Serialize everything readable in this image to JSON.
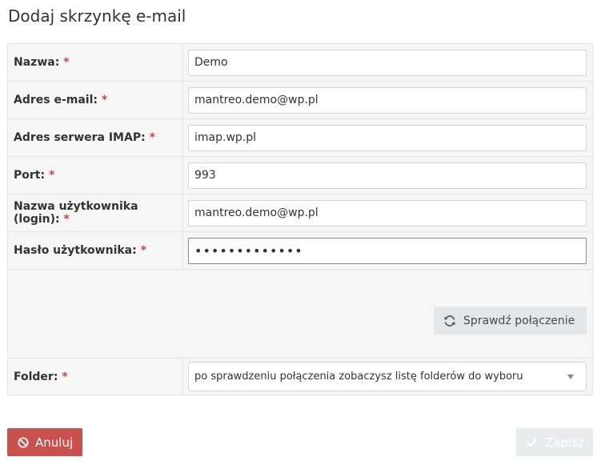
{
  "page": {
    "title": "Dodaj skrzynkę e-mail"
  },
  "form": {
    "required_marker": "*",
    "fields": [
      {
        "label": "Nazwa:",
        "value": "Demo"
      },
      {
        "label": "Adres e-mail:",
        "value": "mantreo.demo@wp.pl"
      },
      {
        "label": "Adres serwera IMAP:",
        "value": "imap.wp.pl"
      },
      {
        "label": "Port:",
        "value": "993"
      },
      {
        "label": "Nazwa użytkownika (login):",
        "value": "mantreo.demo@wp.pl"
      },
      {
        "label": "Hasło użytkownika:",
        "value": "•••••••••••••"
      }
    ],
    "check_connection": {
      "label": "Sprawdź połączenie",
      "icon": "refresh-icon"
    },
    "folder": {
      "label": "Folder:",
      "selected": "po sprawdzeniu połączenia zobaczysz listę folderów do wyboru"
    }
  },
  "actions": {
    "cancel": {
      "label": "Anuluj",
      "icon": "ban-icon",
      "color": "#c9514d"
    },
    "save": {
      "label": "Zapisz",
      "icon": "check-icon",
      "disabled": true
    }
  }
}
